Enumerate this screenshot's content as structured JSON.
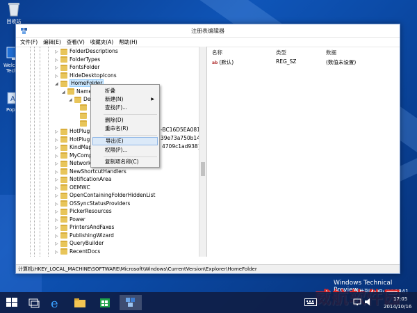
{
  "desktop": {
    "icons": [
      {
        "label": "回收站",
        "icon": "recycle-bin-icon"
      },
      {
        "label": "Welcome Tech P",
        "icon": "welcome-tech-preview-icon"
      },
      {
        "label": "PopCh",
        "icon": "popchar-icon"
      }
    ],
    "watermark_line1": "Windows Technical Preview",
    "watermark_line2": "评估副本. Build 9841",
    "watermark_red": "威航软件园"
  },
  "window": {
    "title": "注册表编辑器",
    "menu": [
      "文件(F)",
      "编辑(E)",
      "查看(V)",
      "收藏夹(A)",
      "帮助(H)"
    ]
  },
  "tree": {
    "nodes": [
      "FolderDescriptions",
      "FolderTypes",
      "FontsFolder",
      "HideDesktopIcons",
      "HomeFolder",
      "Name",
      "De",
      "",
      "",
      "",
      "HotPlugN",
      "HotPlugP",
      "KindMap",
      "MyComp",
      "Network",
      "NewShortcutHandlers",
      "NotificationArea",
      "OEMWC",
      "OpenContainingFolderHiddenList",
      "OSSyncStatusProviders",
      "PickerResources",
      "Power",
      "PrintersAndFaxes",
      "PublishingWizard",
      "QueryBuilder",
      "RecentDocs"
    ],
    "peek": [
      "-BC16D5EA0819}",
      "39e73a750b14}",
      "4709c1ad938}"
    ]
  },
  "values_pane": {
    "headers": [
      "名称",
      "类型",
      "数据"
    ],
    "rows": [
      {
        "name": "(默认)",
        "type": "REG_SZ",
        "data": "(数值未设置)"
      }
    ]
  },
  "context_menu": {
    "items": [
      "折叠",
      "新建(N)",
      "查找(F)...",
      "删除(D)",
      "重命名(R)",
      "导出(E)",
      "权限(P)...",
      "复制项名称(C)"
    ],
    "highlighted": "导出(E)"
  },
  "status": {
    "path": "计算机\\HKEY_LOCAL_MACHINE\\SOFTWARE\\Microsoft\\Windows\\CurrentVersion\\Explorer\\HomeFolder"
  },
  "taskbar": {
    "time": "17:05",
    "date": "2014/10/16"
  },
  "colors": {
    "desktop": "#0f55b8",
    "taskbar": "#0f1e46",
    "selection": "#cce8ff",
    "menu_highlight": "#dbe9f8"
  }
}
